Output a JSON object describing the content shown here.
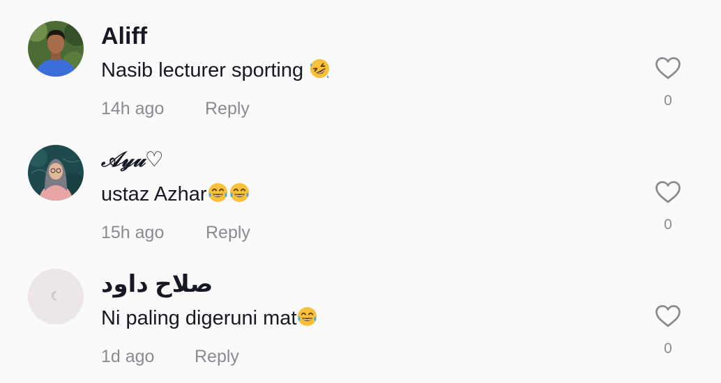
{
  "comments": [
    {
      "username": "Aliff",
      "text": "Nasib lecturer sporting ",
      "emojis": [
        "rolling-on-floor-laughing"
      ],
      "time": "14h ago",
      "reply_label": "Reply",
      "likes": "0"
    },
    {
      "username": "𝒜𝓎𝓊♡",
      "text": "ustaz Azhar",
      "emojis": [
        "tears-of-joy",
        "tears-of-joy"
      ],
      "time": "15h ago",
      "reply_label": "Reply",
      "likes": "0"
    },
    {
      "username": "صلاح داود",
      "text": "Ni paling digeruni mat",
      "emojis": [
        "tears-of-joy"
      ],
      "time": "1d ago",
      "reply_label": "Reply",
      "likes": "0"
    }
  ],
  "icons": {
    "like": "heart-outline-icon",
    "placeholder_avatar": "crescent-moon-icon"
  },
  "colors": {
    "background": "#fafafa",
    "primary_text": "#161823",
    "secondary_text": "#8a8b91",
    "emoji_yellow": "#f7c23a",
    "emoji_tear": "#4aa7e8"
  }
}
